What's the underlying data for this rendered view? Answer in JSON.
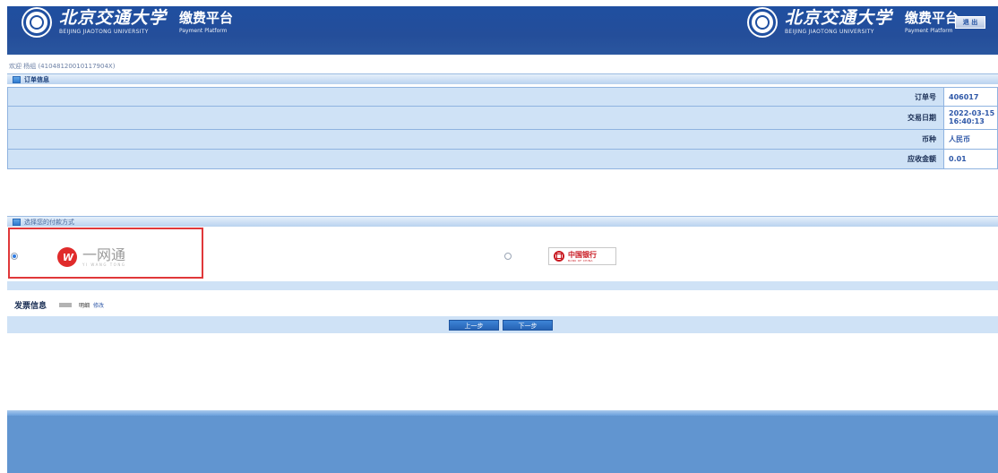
{
  "header": {
    "university_cn": "北京交通大学",
    "university_en": "BEIJING JIAOTONG UNIVERSITY",
    "platform_cn": "缴费平台",
    "platform_en": "Payment Platform",
    "logout_label": "退 出"
  },
  "welcome": "欢迎 杨组 (41048120010117904X)",
  "order_section": {
    "title": "订单信息",
    "rows": [
      {
        "label": "订单号",
        "value": "406017"
      },
      {
        "label": "交易日期",
        "value_line1": "2022-03-15",
        "value_line2": "16:40:13"
      },
      {
        "label": "币种",
        "value": "人民币"
      },
      {
        "label": "应收金额",
        "value": "0.01"
      }
    ]
  },
  "payment_section": {
    "title": "选择您的付款方式",
    "options": [
      {
        "name": "一网通",
        "sub": "YI WANG TONG",
        "mark": "W",
        "selected": true
      },
      {
        "name": "中国银行",
        "sub": "BANK OF CHINA",
        "selected": false
      }
    ]
  },
  "invoice": {
    "label": "发票信息",
    "detail": "明细",
    "modify": "修改"
  },
  "nav": {
    "prev": "上一步",
    "next": "下一步"
  },
  "colors": {
    "header_bg": "#244e9a",
    "row_bg": "#cfe2f6",
    "highlight": "#e0383a",
    "footer_bg": "#6195d0"
  }
}
